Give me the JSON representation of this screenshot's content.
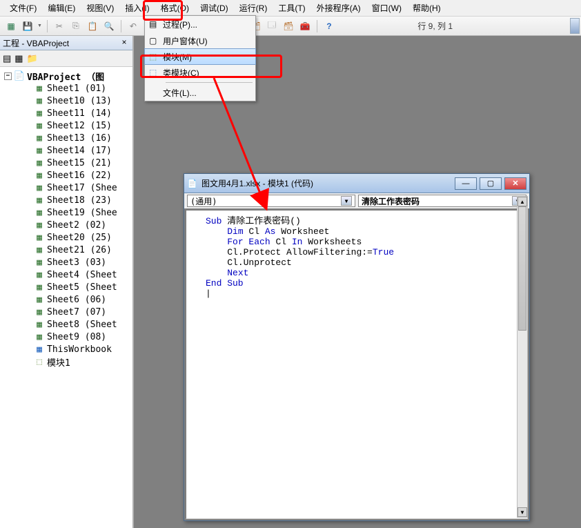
{
  "menubar": {
    "file": "文件(F)",
    "edit": "编辑(E)",
    "view": "视图(V)",
    "insert": "插入(I)",
    "format": "格式(O)",
    "debug": "调试(D)",
    "run": "运行(R)",
    "tools": "工具(T)",
    "addins": "外接程序(A)",
    "window": "窗口(W)",
    "help": "帮助(H)"
  },
  "insert_menu": {
    "procedure": "过程(P)...",
    "userform": "用户窗体(U)",
    "module": "模块(M)",
    "class_module": "类模块(C)",
    "file": "文件(L)..."
  },
  "toolbar": {
    "position": "行 9, 列 1"
  },
  "project_pane": {
    "title": "工程 - VBAProject",
    "root": "VBAProject （图",
    "items": [
      "Sheet1 (01)",
      "Sheet10 (13)",
      "Sheet11 (14)",
      "Sheet12 (15)",
      "Sheet13 (16)",
      "Sheet14 (17)",
      "Sheet15 (21)",
      "Sheet16 (22)",
      "Sheet17 (Shee",
      "Sheet18 (23)",
      "Sheet19 (Shee",
      "Sheet2 (02)",
      "Sheet20 (25)",
      "Sheet21 (26)",
      "Sheet3 (03)",
      "Sheet4 (Sheet",
      "Sheet5 (Sheet",
      "Sheet6 (06)",
      "Sheet7 (07)",
      "Sheet8 (Sheet",
      "Sheet9 (08)",
      "ThisWorkbook"
    ],
    "module": "模块1"
  },
  "code_window": {
    "title": "图文用4月1.xlsx - 模块1 (代码)",
    "dropdown_left": "(通用)",
    "dropdown_right": "清除工作表密码",
    "code": {
      "l1_kw": "Sub",
      "l1_rest": " 清除工作表密码()",
      "l2_kw": "Dim",
      "l2_rest": " Cl ",
      "l2_kw2": "As",
      "l2_rest2": " Worksheet",
      "l3_kw": "For Each",
      "l3_rest": " Cl ",
      "l3_kw2": "In",
      "l3_rest2": " Worksheets",
      "l4": "Cl.Protect AllowFiltering:=",
      "l4_kw": "True",
      "l5": "Cl.Unprotect",
      "l6_kw": "Next",
      "l7_kw": "End Sub"
    }
  }
}
